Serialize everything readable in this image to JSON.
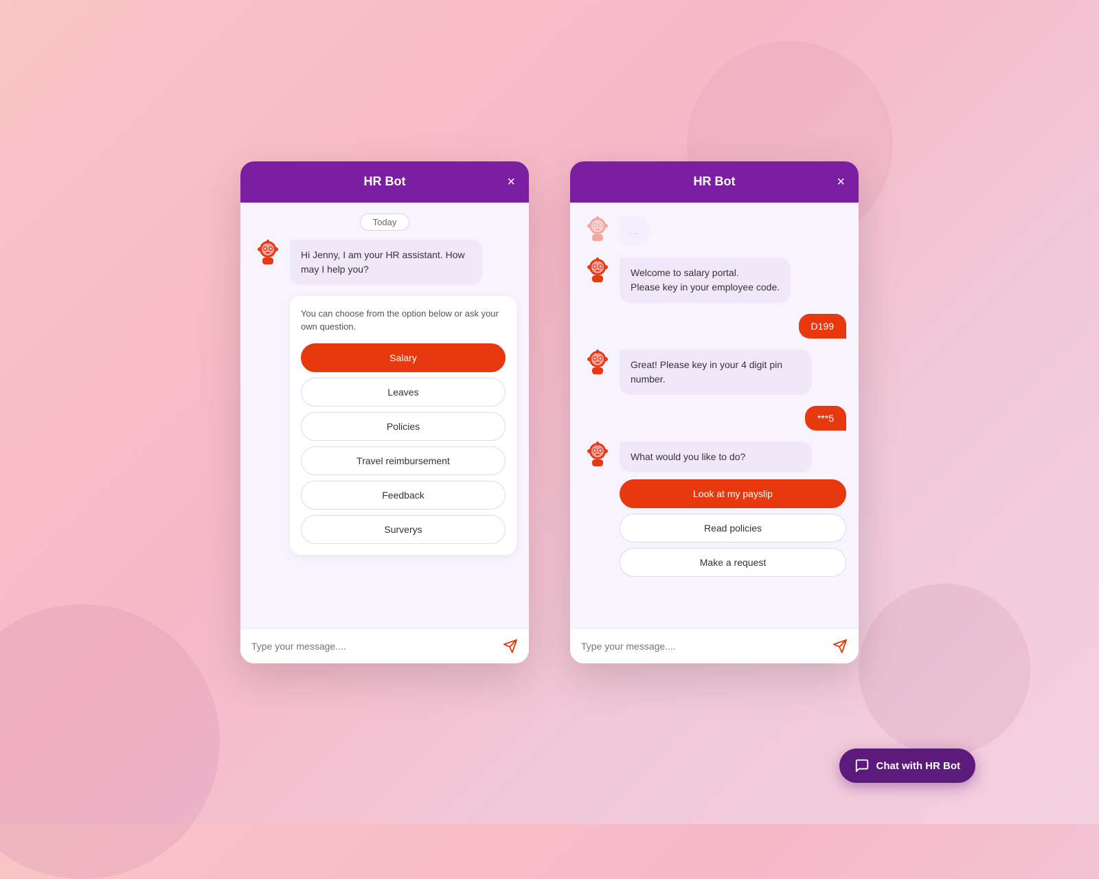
{
  "background": {
    "color_start": "#f9c5c5",
    "color_end": "#f5d0e0"
  },
  "left_window": {
    "header": {
      "title": "HR Bot",
      "close_label": "×"
    },
    "date_badge": "Today",
    "bot_greeting": "Hi Jenny, I am your HR assistant.\nHow may I help you?",
    "options_intro": "You can choose from the option below or ask your own question.",
    "options": [
      {
        "label": "Salary",
        "active": true
      },
      {
        "label": "Leaves",
        "active": false
      },
      {
        "label": "Policies",
        "active": false
      },
      {
        "label": "Travel reimbursement",
        "active": false
      },
      {
        "label": "Feedback",
        "active": false
      },
      {
        "label": "Surverys",
        "active": false
      }
    ],
    "input_placeholder": "Type your message...."
  },
  "right_window": {
    "header": {
      "title": "HR Bot",
      "close_label": "×"
    },
    "messages": [
      {
        "type": "bot_faded",
        "text": ""
      },
      {
        "type": "bot",
        "text": "Welcome to salary portal.\nPlease key in your employee code."
      },
      {
        "type": "user",
        "text": "D199"
      },
      {
        "type": "bot",
        "text": "Great! Please key in your 4 digit pin number."
      },
      {
        "type": "user",
        "text": "***5"
      },
      {
        "type": "bot",
        "text": "What would you like to do?"
      }
    ],
    "options": [
      {
        "label": "Look at my payslip",
        "active": true
      },
      {
        "label": "Read policies",
        "active": false
      },
      {
        "label": "Make a request",
        "active": false
      }
    ],
    "input_placeholder": "Type your message...."
  },
  "float_button": {
    "label": "Chat with HR Bot",
    "icon": "chat-icon"
  },
  "colors": {
    "header_purple": "#7b1fa2",
    "active_red": "#e8380d",
    "bot_bubble_bg": "#f0e8f8",
    "float_btn_bg": "#5c1a7a"
  }
}
